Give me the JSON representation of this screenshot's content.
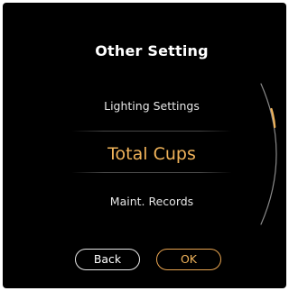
{
  "screen": {
    "title": "Other Setting"
  },
  "menu": {
    "items": [
      {
        "label": "Lighting Settings"
      },
      {
        "label": "Total Cups",
        "selected": true
      },
      {
        "label": "Maint. Records"
      }
    ]
  },
  "buttons": {
    "back_label": "Back",
    "ok_label": "OK"
  },
  "colors": {
    "background": "#000000",
    "text": "#ffffff",
    "accent": "#f0b35a",
    "scroll_track": "#8a8a8a"
  }
}
